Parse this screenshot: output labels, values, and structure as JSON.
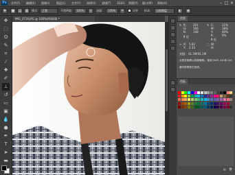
{
  "app": {
    "logo": "Ps",
    "menu": [
      "文件(F)",
      "编辑(E)",
      "图像(I)",
      "图层(L)",
      "文字(Y)",
      "选择(S)",
      "滤镜(T)",
      "3D(D)",
      "视图(V)",
      "窗口(W)",
      "帮助(H)"
    ]
  },
  "options": {
    "mode_label": "模式:",
    "mode_value": "正常",
    "opacity_label": "不透明度:",
    "opacity_value": "100%",
    "flow_label": "流量:",
    "flow_value": "100%",
    "sample_label": "对齐",
    "sample_mode_label": "样本:",
    "sample_mode_value": "当前图层"
  },
  "document": {
    "tab_label": "IMG_3719.JPG @ 100%(RGB/8) *"
  },
  "info_panel": {
    "tab_label": "信息",
    "r_label": "R:",
    "r_value": "201",
    "g_label": "G:",
    "g_value": "166",
    "b_label": "B:",
    "b_value": "148",
    "c_label": "C:",
    "c_value": "21%",
    "m_label": "M:",
    "m_value": "38%",
    "y_label": "Y:",
    "y_value": "40%",
    "k_label": "K:",
    "k_value": "0%",
    "bit_left": "8 位",
    "bit_right": "8 位",
    "x_label": "X:",
    "x_value": "5.82",
    "y2_label": "Y:",
    "y2_value": "2.33",
    "w_label": "W:",
    "h_label": "H:",
    "doc_label": "文档:",
    "doc_value": "41.1M/41.1M",
    "hint_line1": "点按并拖移以用源像素... 使用 Shift, Alt 和 Ctrl",
    "hint_line2": "键可获得其它选项。"
  },
  "swatches_panel": {
    "tab_label": "色板",
    "colors": [
      "#ff0000",
      "#ffff00",
      "#00ff00",
      "#00ffff",
      "#0000ff",
      "#ff00ff",
      "#ffffff",
      "#e0e0e0",
      "#c0c0c0",
      "#a0a0a0",
      "#808080",
      "#606060",
      "#404040",
      "#202020",
      "#000000",
      "#ff8080",
      "#ffcc80",
      "#ed1c24",
      "#f7941d",
      "#fff200",
      "#8dc63f",
      "#00a651",
      "#00a99d",
      "#00aeef",
      "#0072bc",
      "#2e3192",
      "#662d91",
      "#92278f",
      "#ec008c",
      "#ed145b",
      "#c69c6d",
      "#8c6239",
      "#603813",
      "#363636",
      "#f26c4f",
      "#f68e55",
      "#fbaf5c",
      "#fff467",
      "#acd372",
      "#7cc576",
      "#3bb878",
      "#1abbb4",
      "#00bff3",
      "#438ccb",
      "#5574b9",
      "#605ca8",
      "#855fa8",
      "#a763a8",
      "#f06ea9",
      "#f26d7d",
      "#998675",
      "#9e0b0f",
      "#a0410d",
      "#a36209",
      "#aba000",
      "#598527",
      "#1a7b30",
      "#007236",
      "#00746b",
      "#0076a3",
      "#004a80",
      "#003471",
      "#1b1464",
      "#440e62",
      "#630460",
      "#9e005d",
      "#9e0039",
      "#534741",
      "#790000",
      "#7b2e00",
      "#7d4900",
      "#827b00",
      "#406618",
      "#005e20",
      "#005826",
      "#005952",
      "#005b7f",
      "#003663",
      "#002157",
      "#0d004c",
      "#32004b",
      "#4b0049",
      "#7b0046",
      "#7a0026",
      "#362f2d"
    ]
  }
}
